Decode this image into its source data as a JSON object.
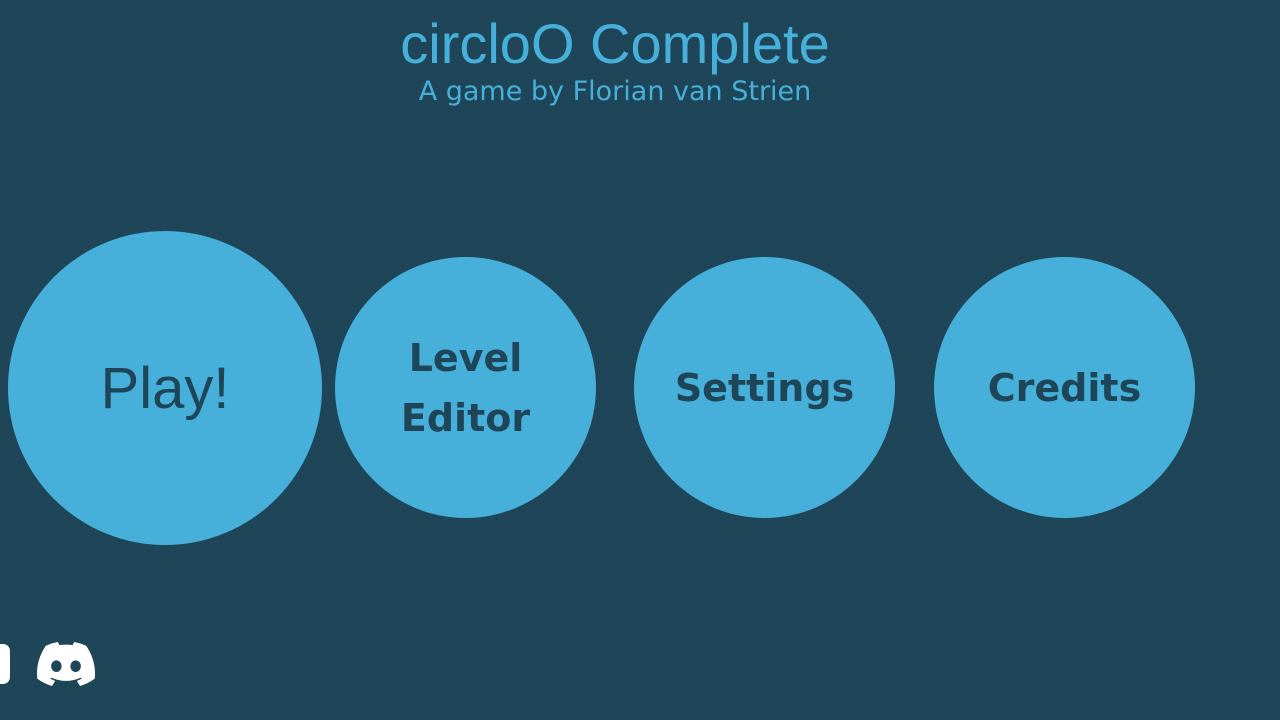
{
  "title": "circloO Complete",
  "subtitle": "A game by Florian van Strien",
  "menu": {
    "play": "Play!",
    "level_editor": "Level Editor",
    "settings": "Settings",
    "credits": "Credits"
  },
  "icons": {
    "left_partial": "partial-social-icon",
    "discord": "discord-icon"
  },
  "colors": {
    "background": "#1e4658",
    "accent": "#47b0da",
    "icon": "#ffffff"
  }
}
